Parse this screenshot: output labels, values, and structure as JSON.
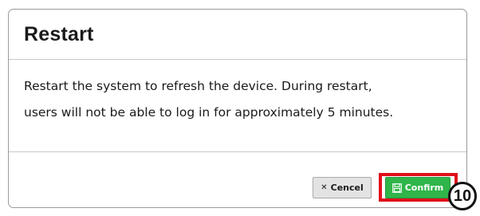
{
  "dialog": {
    "title": "Restart",
    "message_line1": "Restart the system to refresh the device. During restart,",
    "message_line2": "users will not be able to log in for approximately 5 minutes."
  },
  "buttons": {
    "cancel_label": "Cencel",
    "cancel_icon": "x-icon",
    "confirm_label": "Confirm",
    "confirm_icon": "save-icon"
  },
  "annotation": {
    "step_number": "10",
    "highlight_color": "#e0101a"
  },
  "colors": {
    "confirm_bg": "#2fb54a",
    "cancel_bg": "#e3e3e3"
  }
}
